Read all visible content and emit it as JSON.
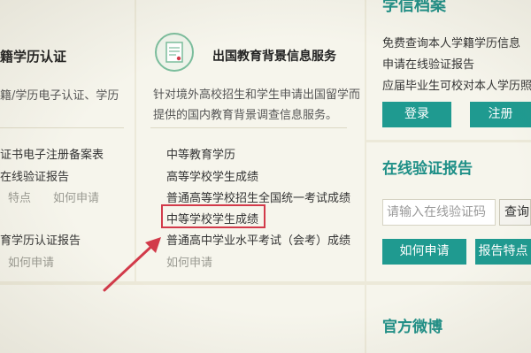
{
  "left_column": {
    "title": "籍学历认证",
    "desc": "籍/学历电子认证、学历",
    "item_1": "证书电子注册备案表",
    "item_2": "在线验证报告",
    "links_1": [
      "特点",
      "如何申请"
    ],
    "item_3": "育学历认证报告",
    "links_2": [
      "如何申请"
    ]
  },
  "middle_column": {
    "title": "出国教育背景信息服务",
    "desc_line_1": "针对境外高校招生和学生申请出国留学而",
    "desc_line_2": "提供的国内教育背景调查信息服务。",
    "items": [
      "中等教育学历",
      "高等学校学生成绩",
      "普通高等学校招生全国统一考试成绩",
      "中等学校学生成绩",
      "普通高中学业水平考试（会考）成绩"
    ],
    "link": "如何申请"
  },
  "right_column": {
    "top_title": "学信档案",
    "lines": [
      "免费查询本人学籍学历信息",
      "申请在线验证报告",
      "应届毕业生可校对本人学历照片"
    ],
    "login_label": "登录",
    "register_label": "注册",
    "verify_title": "在线验证报告",
    "verify_placeholder": "请输入在线验证码",
    "query_label": "查询",
    "how_to_apply_label": "如何申请",
    "report_features_label": "报告特点",
    "weibo_title": "官方微博"
  },
  "colors": {
    "accent": "#1f9a90",
    "highlight": "#d23a4a"
  },
  "icons": {
    "certificate": "certificate-icon",
    "arrow": "red-arrow-annotation"
  }
}
